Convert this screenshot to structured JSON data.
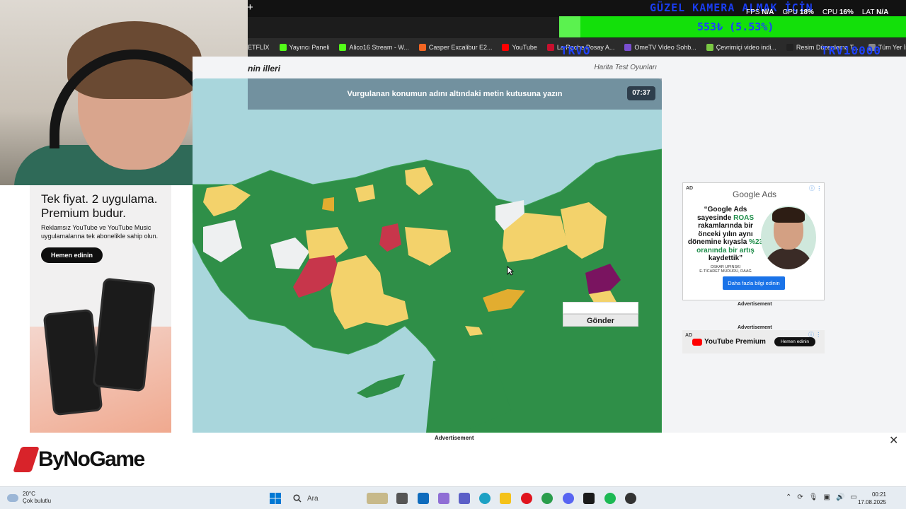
{
  "browser": {
    "new_tab": "+",
    "bookmarks": [
      {
        "label": "ETFLİX",
        "color": "#e50914"
      },
      {
        "label": "Yayıncı Paneli",
        "color": "#53fc18"
      },
      {
        "label": "Alico16 Stream - W...",
        "color": "#53fc18"
      },
      {
        "label": "Casper Excalibur E2...",
        "color": "#f26522"
      },
      {
        "label": "YouTube",
        "color": "#ff0000"
      },
      {
        "label": "La Roche Posay A...",
        "color": "#c8102e"
      },
      {
        "label": "OmeTV Video Sohb...",
        "color": "#7a4fd0"
      },
      {
        "label": "Çevrimiçi video indi...",
        "color": "#7ac943"
      },
      {
        "label": "Resim Düzenleme T...",
        "color": "#222222"
      },
      {
        "label": "Tüm Yer İşaretleri",
        "color": "#888888"
      }
    ]
  },
  "overlay": {
    "title": "GÜZEL KAMERA ALMAK İÇİN",
    "fps_label": "FPS",
    "fps_value": "N/A",
    "gpu_label": "GPU",
    "gpu_value": "18%",
    "cpu_label": "CPU",
    "cpu_value": "16%",
    "lat_label": "LAT",
    "lat_value": "N/A",
    "donation": "553₺ (5.53%)",
    "trvo_left": "TRVO",
    "trvo_right": "TRV10000"
  },
  "page": {
    "title_fragment": "nin illeri",
    "site_link": "Harita Test Oyunları"
  },
  "game": {
    "prompt": "Vurgulanan konumun adını altındaki metin kutusuna yazın",
    "timer": "07:37",
    "answer_placeholder": "",
    "submit_label": "Gönder",
    "colors": {
      "sea": "#a9d6dc",
      "correct": "#2f8f48",
      "almost": "#f3d26b",
      "wrong": "#c7364b",
      "unanswered": "#eef0f1",
      "highlight": "#7a1460",
      "partial": "#e2ad30"
    }
  },
  "left_ad": {
    "headline": "Tek fiyat. 2 uygulama. Premium budur.",
    "subtext": "Reklamsız YouTube ve YouTube Music uygulamalarına tek abonelikle sahip olun.",
    "button": "Hemen edinin"
  },
  "right_ad": {
    "tag": "AD",
    "brand": "Google Ads",
    "text_before": "“Google Ads sayesinde ",
    "highlight1": "ROAS",
    "text_mid": " rakamlarında bir önceki yılın aynı dönemine kıyasla ",
    "highlight2": "%23 oranında bir artış",
    "text_after": " kaydettik”",
    "caption": "OSKAR UPINSKI\nE-TİCARET MÜDÜRÜ, DAAG",
    "button": "Daha fazla bilgi edinin",
    "advertisement_label_1": "Advertisement",
    "advertisement_label_2": "Advertisement",
    "yt_premium_tag": "AD",
    "yt_premium_logo": "YouTube Premium",
    "yt_premium_button": "Hemen edinin"
  },
  "bottom_ad": {
    "label": "Advertisement",
    "brand": "ByNoGame",
    "close": "✕"
  },
  "taskbar": {
    "temperature": "20°C",
    "condition": "Çok bulutlu",
    "search_placeholder": "Ara",
    "time": "00:21",
    "date": "17.08.2025"
  }
}
